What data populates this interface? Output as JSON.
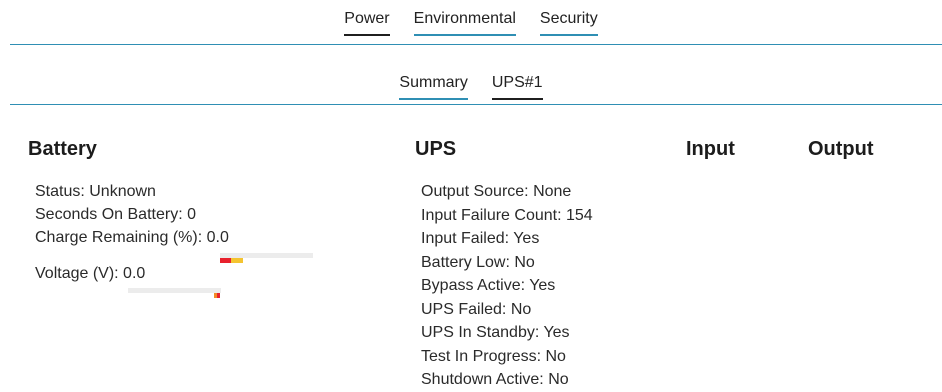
{
  "top_tabs": [
    {
      "label": "Power",
      "active": true
    },
    {
      "label": "Environmental",
      "active": false
    },
    {
      "label": "Security",
      "active": false
    }
  ],
  "sub_tabs": [
    {
      "label": "Summary",
      "active": false
    },
    {
      "label": "UPS#1",
      "active": true
    }
  ],
  "battery": {
    "heading": "Battery",
    "status": "Status: Unknown",
    "seconds_on_battery": "Seconds On Battery: 0",
    "charge_remaining": "Charge Remaining (%): 0.0",
    "voltage": "Voltage (V): 0.0",
    "charge_level": 0.0,
    "voltage_level": 0.0,
    "colors": {
      "red": "#e8212d",
      "yellow": "#f4c430",
      "orange": "#f28c28",
      "track": "#ececec"
    }
  },
  "ups": {
    "heading": "UPS",
    "lines": [
      "Output Source: None",
      "Input Failure Count: 154",
      "Input Failed: Yes",
      "Battery Low: No",
      "Bypass Active: Yes",
      "UPS Failed: No",
      "UPS In Standby: Yes",
      "Test In Progress: No",
      "Shutdown Active: No"
    ]
  },
  "input": {
    "heading": "Input"
  },
  "output": {
    "heading": "Output"
  }
}
